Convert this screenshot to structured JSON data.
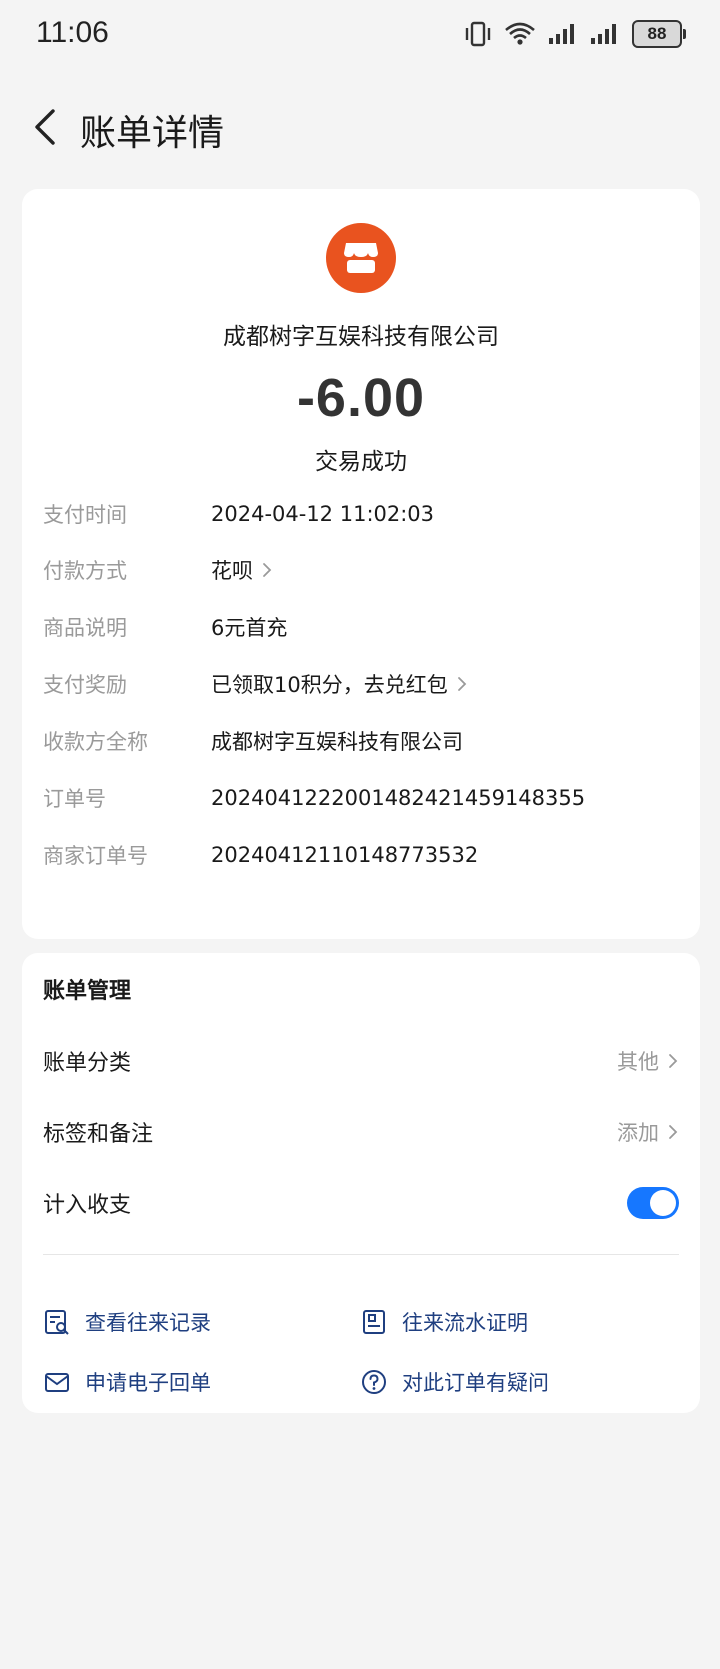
{
  "status_bar": {
    "time": "11:06",
    "battery": "88"
  },
  "nav": {
    "title": "账单详情"
  },
  "transaction": {
    "merchant": "成都树字互娱科技有限公司",
    "amount": "-6.00",
    "status": "交易成功"
  },
  "details": [
    {
      "label": "支付时间",
      "value": "2024-04-12 11:02:03",
      "link": false
    },
    {
      "label": "付款方式",
      "value": "花呗",
      "link": true
    },
    {
      "label": "商品说明",
      "value": "6元首充",
      "link": false
    },
    {
      "label": "支付奖励",
      "value": "已领取10积分，去兑红包",
      "link": true
    },
    {
      "label": "收款方全称",
      "value": "成都树字互娱科技有限公司",
      "link": false
    },
    {
      "label": "订单号",
      "value": "2024041222001482421459148355",
      "link": false
    },
    {
      "label": "商家订单号",
      "value": "20240412110148773532",
      "link": false
    }
  ],
  "manage": {
    "title": "账单管理",
    "category_label": "账单分类",
    "category_value": "其他",
    "tags_label": "标签和备注",
    "tags_value": "添加",
    "income_label": "计入收支",
    "income_enabled": true
  },
  "actions": [
    {
      "label": "查看往来记录",
      "icon": "record-search-icon"
    },
    {
      "label": "往来流水证明",
      "icon": "statement-icon"
    },
    {
      "label": "申请电子回单",
      "icon": "mail-icon"
    },
    {
      "label": "对此订单有疑问",
      "icon": "question-icon"
    }
  ],
  "colors": {
    "accent": "#1677ff",
    "merchant_logo": "#e9531f",
    "action_text": "#1f3f80"
  }
}
